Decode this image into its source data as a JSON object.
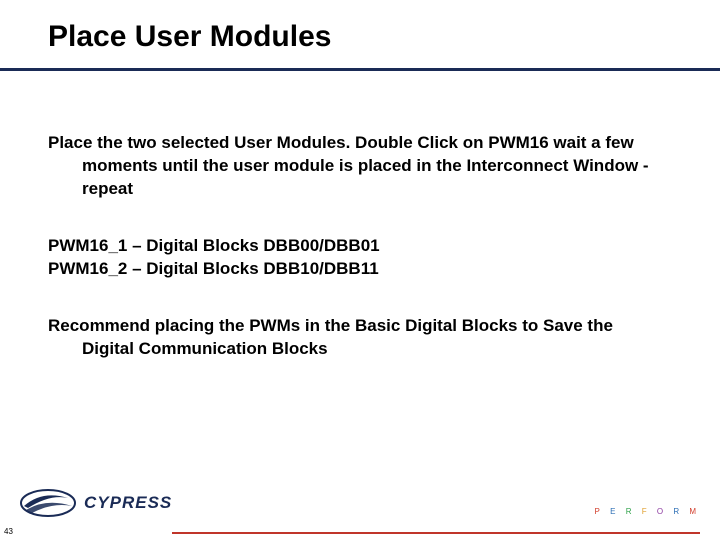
{
  "slide": {
    "title": "Place User Modules",
    "number": "43",
    "paragraphs": {
      "intro": "Place the two selected User Modules. Double Click on PWM16 wait a few moments until the user module is placed in the Interconnect Window - repeat",
      "pwm1": "PWM16_1 – Digital Blocks DBB00/DBB01",
      "pwm2": "PWM16_2 – Digital Blocks DBB10/DBB11",
      "recommend": "Recommend placing the PWMs in the Basic Digital Blocks to Save the Digital Communication Blocks"
    }
  },
  "footer": {
    "brand": "CYPRESS",
    "tagline_letters": {
      "p": "P",
      "e": "E",
      "r": "R",
      "f": "F",
      "o": "O",
      "r2": "R",
      "m": "M"
    }
  }
}
